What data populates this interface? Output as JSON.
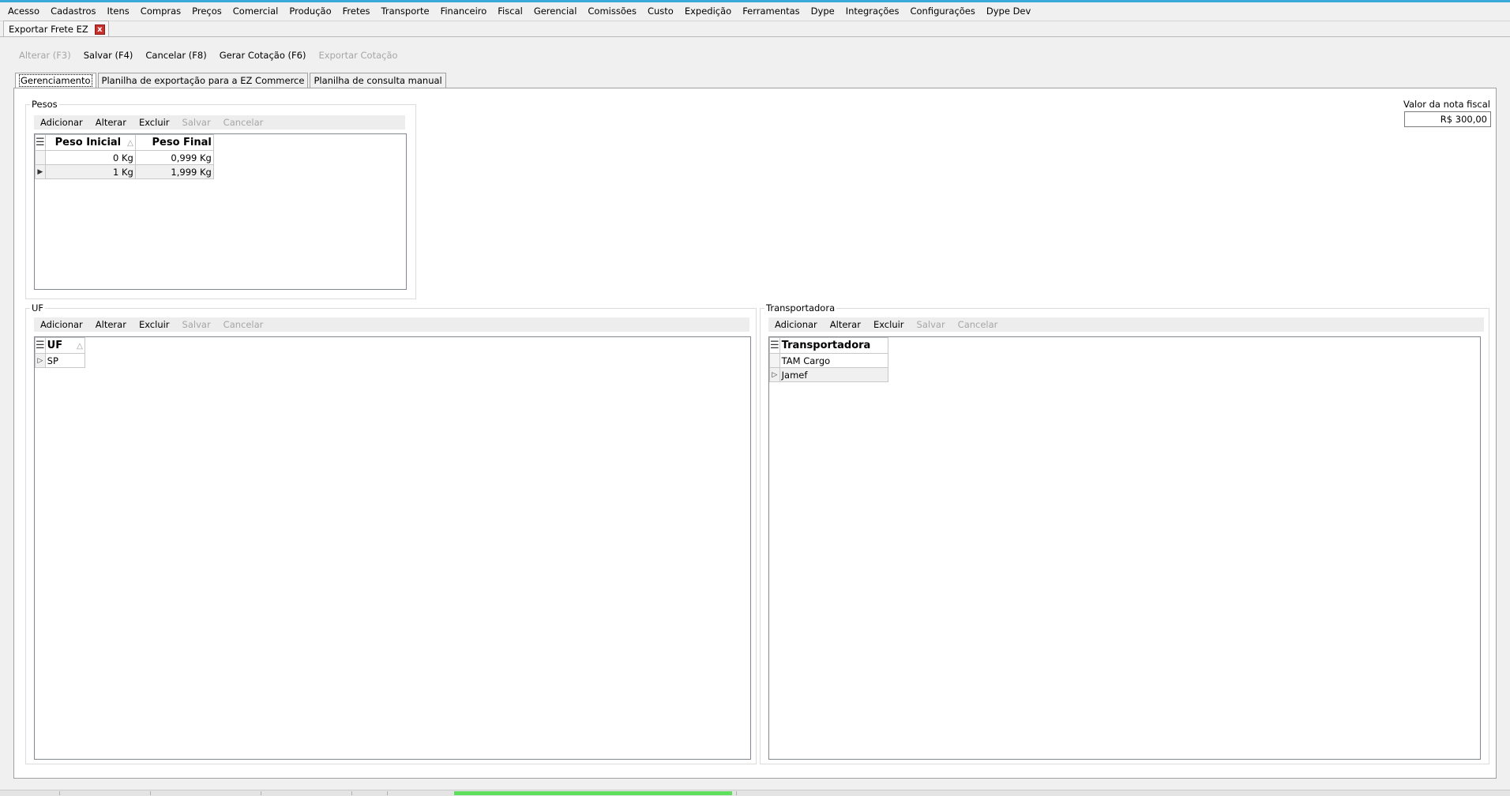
{
  "menu": [
    "Acesso",
    "Cadastros",
    "Itens",
    "Compras",
    "Preços",
    "Comercial",
    "Produção",
    "Fretes",
    "Transporte",
    "Financeiro",
    "Fiscal",
    "Gerencial",
    "Comissões",
    "Custo",
    "Expedição",
    "Ferramentas",
    "Dype",
    "Integrações",
    "Configurações",
    "Dype Dev"
  ],
  "doc_tab": {
    "label": "Exportar Frete EZ",
    "close_label": "x"
  },
  "toolbar": {
    "alterar": "Alterar (F3)",
    "salvar": "Salvar (F4)",
    "cancelar": "Cancelar (F8)",
    "gerar": "Gerar Cotação (F6)",
    "exportar": "Exportar Cotação"
  },
  "tabs": [
    "Gerenciamento",
    "Planilha de exportação para a EZ Commerce",
    "Planilha de consulta manual"
  ],
  "subbar": {
    "adicionar": "Adicionar",
    "alterar": "Alterar",
    "excluir": "Excluir",
    "salvar": "Salvar",
    "cancelar": "Cancelar"
  },
  "pesos": {
    "title": "Pesos",
    "headers": {
      "inicial": "Peso Inicial",
      "final": "Peso Final"
    },
    "rows": [
      {
        "inicial": "0 Kg",
        "final": "0,999 Kg"
      },
      {
        "inicial": "1 Kg",
        "final": "1,999 Kg"
      }
    ]
  },
  "uf": {
    "title": "UF",
    "header": "UF",
    "rows": [
      "SP"
    ]
  },
  "transportadora": {
    "title": "Transportadora",
    "header": "Transportadora",
    "rows": [
      "TAM Cargo",
      "Jamef"
    ]
  },
  "valor_nota": {
    "label": "Valor da nota fiscal",
    "value": "R$ 300,00"
  }
}
